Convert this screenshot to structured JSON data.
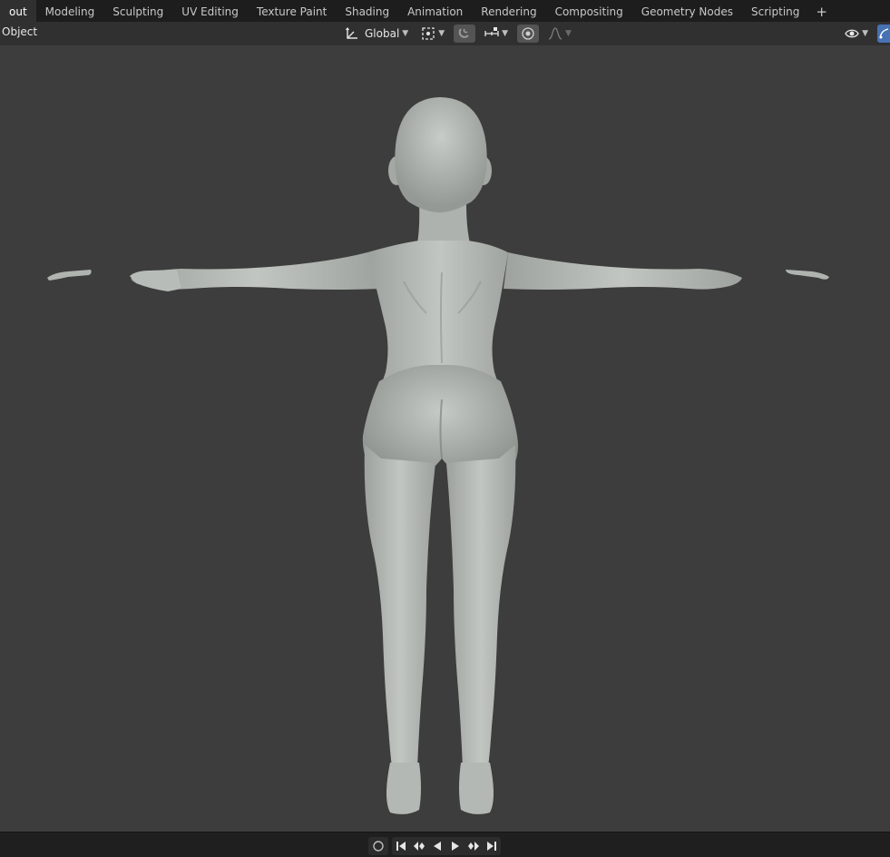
{
  "workspace_tabs": [
    {
      "label": "out",
      "active": true
    },
    {
      "label": "Modeling",
      "active": false
    },
    {
      "label": "Sculpting",
      "active": false
    },
    {
      "label": "UV Editing",
      "active": false
    },
    {
      "label": "Texture Paint",
      "active": false
    },
    {
      "label": "Shading",
      "active": false
    },
    {
      "label": "Animation",
      "active": false
    },
    {
      "label": "Rendering",
      "active": false
    },
    {
      "label": "Compositing",
      "active": false
    },
    {
      "label": "Geometry Nodes",
      "active": false
    },
    {
      "label": "Scripting",
      "active": false
    }
  ],
  "add_tab_label": "+",
  "header": {
    "mode_label": "Object",
    "orientation_label": "Global"
  },
  "colors": {
    "viewport_bg": "#3d3d3d",
    "header_bg": "#303030",
    "topbar_bg": "#1d1d1d",
    "accent_blue": "#4772b3",
    "model_gray": "#b4b8b4"
  },
  "icons": {
    "orientation": "transform-orientation-icon",
    "pivot": "pivot-point-icon",
    "snap": "snap-magnet-icon",
    "snap_target": "snap-increment-icon",
    "proportional": "proportional-editing-icon",
    "falloff": "falloff-curve-icon",
    "visibility": "eye-visibility-icon",
    "gizmo": "gizmo-toggle-icon",
    "record": "record-circle-icon",
    "jump_start": "jump-start-icon",
    "prev_keyframe": "prev-keyframe-icon",
    "play_reverse": "play-reverse-icon",
    "play": "play-icon",
    "next_keyframe": "next-keyframe-icon",
    "jump_end": "jump-end-icon"
  }
}
